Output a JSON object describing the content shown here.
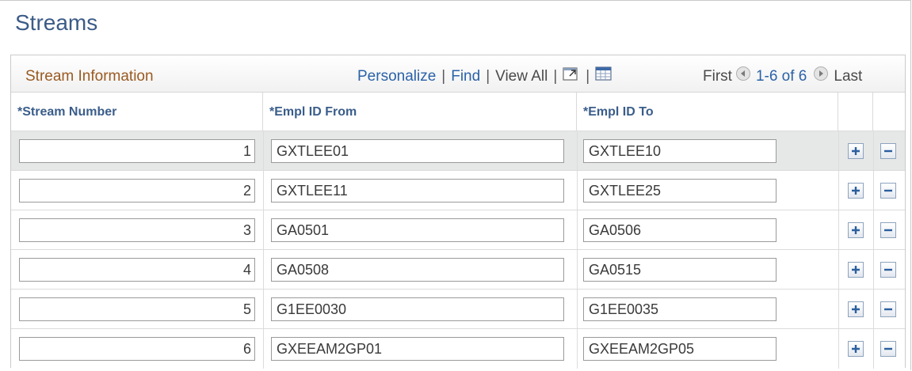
{
  "page": {
    "title": "Streams"
  },
  "grid": {
    "title": "Stream Information",
    "links": {
      "personalize": "Personalize",
      "find": "Find",
      "view_all": "View All"
    },
    "pager": {
      "first": "First",
      "range": "1-6 of 6",
      "last": "Last"
    },
    "columns": {
      "stream_number": "*Stream Number",
      "empl_from": "*Empl ID From",
      "empl_to": "*Empl ID To"
    },
    "rows": [
      {
        "number": "1",
        "from": "GXTLEE01",
        "to": "GXTLEE10"
      },
      {
        "number": "2",
        "from": "GXTLEE11",
        "to": "GXTLEE25"
      },
      {
        "number": "3",
        "from": "GA0501",
        "to": "GA0506"
      },
      {
        "number": "4",
        "from": "GA0508",
        "to": "GA0515"
      },
      {
        "number": "5",
        "from": "G1EE0030",
        "to": "G1EE0035"
      },
      {
        "number": "6",
        "from": "GXEEAM2GP01",
        "to": "GXEEAM2GP05"
      }
    ]
  },
  "icons": {
    "zoom": "new-window-icon",
    "download": "spreadsheet-icon",
    "prev": "previous-circle-icon",
    "next": "next-circle-icon",
    "add": "add-row-icon",
    "delete": "delete-row-icon"
  },
  "colors": {
    "title": "#3b5b87",
    "grid_title": "#9a5a21",
    "link": "#2b62a8",
    "column_header": "#3a5d8a",
    "active_row": "#e6e8e8"
  }
}
